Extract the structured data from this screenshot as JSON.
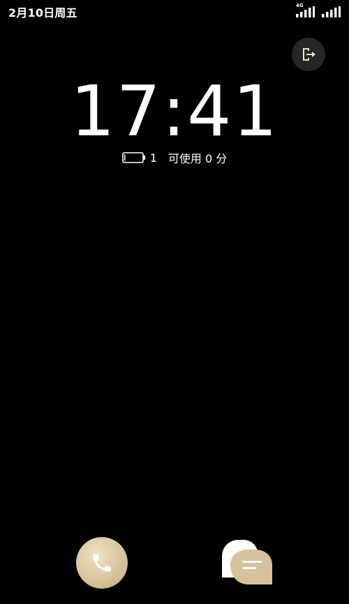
{
  "status_bar": {
    "date": "2月10日周五",
    "network_type": "4G",
    "sim1_signal_icon": "signal-bars-icon",
    "sim2_signal_icon": "signal-bars-icon"
  },
  "lock_screen": {
    "time": "17:41",
    "battery_level": "1",
    "battery_remaining": "可使用 0 分",
    "exit_icon": "exit-icon"
  },
  "shortcuts": {
    "phone_icon": "phone-icon",
    "message_icon": "message-icon"
  },
  "colors": {
    "background": "#000000",
    "accent_gold": "#d9c49c",
    "exit_button_bg": "#262626",
    "exit_icon": "#f0e2c0"
  }
}
